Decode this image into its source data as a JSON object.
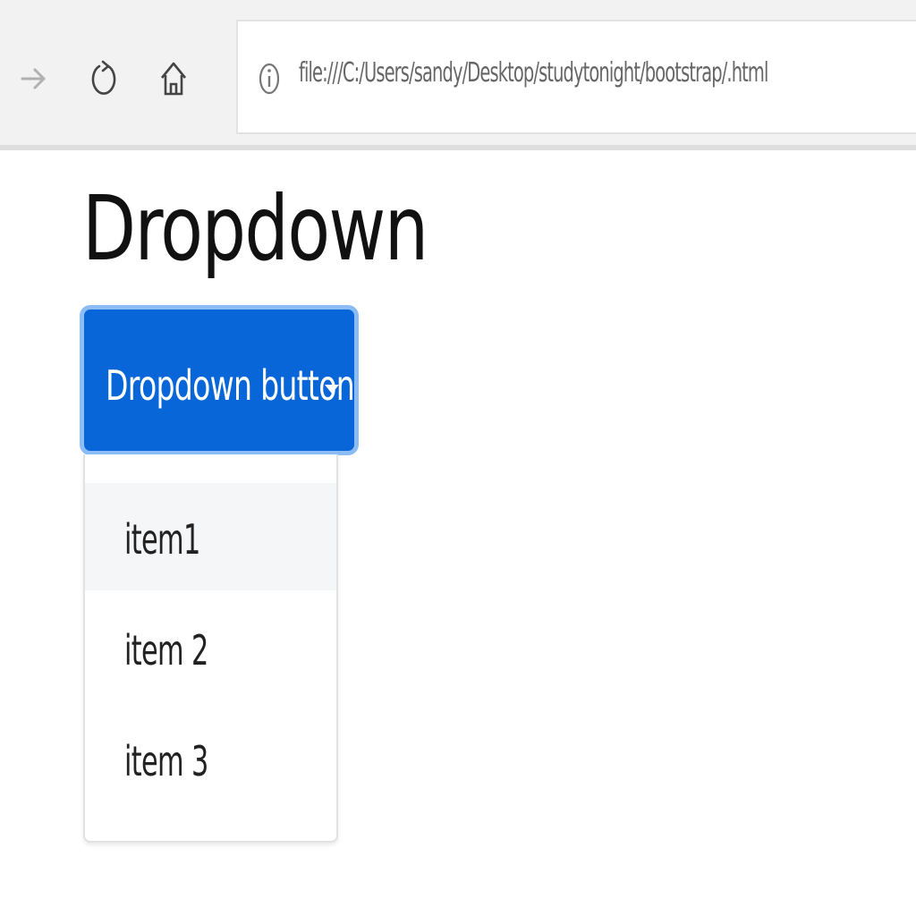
{
  "browser": {
    "address_bar": {
      "url": "file:///C:/Users/sandy/Desktop/studytonight/bootstrap/.html"
    },
    "icons": {
      "forward": "forward-arrow-icon",
      "refresh": "refresh-icon",
      "home": "home-icon",
      "info": "info-icon"
    }
  },
  "page": {
    "title": "Dropdown",
    "dropdown": {
      "button_label": "Dropdown button",
      "button_color": "#0866d9",
      "caret_icon": "caret-down-icon",
      "items": [
        {
          "label": "item1",
          "highlighted": true
        },
        {
          "label": "item 2",
          "highlighted": false
        },
        {
          "label": "item 3",
          "highlighted": false
        }
      ]
    }
  }
}
